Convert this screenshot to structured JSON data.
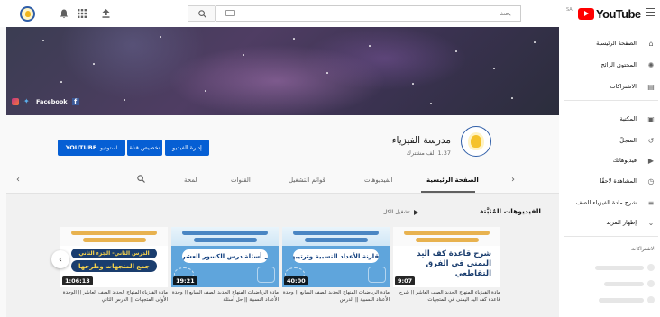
{
  "topbar": {
    "search_placeholder": "بحث",
    "logo_text": "YouTube",
    "logo_sup": "SA"
  },
  "banner": {
    "facebook_label": "Facebook"
  },
  "channel": {
    "name": "مدرسة الفيزياء",
    "subscribers": "1.37 ألف مشترك",
    "btn_youtube_main": "YOUTUBE",
    "btn_youtube_small": "استوديو",
    "btn_customize": "تخصيص قناة",
    "btn_manage": "إدارة الفيديو"
  },
  "tabs": [
    {
      "label": "الصفحة الرئيسية"
    },
    {
      "label": "الفيديوهات"
    },
    {
      "label": "قوائم التشغيل"
    },
    {
      "label": "القنوات"
    },
    {
      "label": "لمحة"
    }
  ],
  "shelf": {
    "title": "الفيديوهات المُثبَّتة",
    "play_all": "تشغيل الكل"
  },
  "videos": [
    {
      "thumb_text": "شرح قاعدة كف اليد اليمنى في الفرق التقاطعي",
      "duration": "9:07",
      "title": "مادة الفيزياء المنهاج الجديد الصف العاشر || شرح قاعدة كف اليد اليمنى في المتجهات"
    },
    {
      "thumb_text": "مقارنة الأعداد النسبية وترتيبها",
      "duration": "40:00",
      "title": "مادة الرياضيات المنهاج الجديد الصف السابع || وحدة الأعداد النسبية || الدرس"
    },
    {
      "thumb_text": "حل أسئلة درس الكسور العشرية",
      "duration": "19:21",
      "title": "مادة الرياضيات المنهاج الجديد الصف السابع || وحدة الأعداد النسبية || حل أسئلة"
    },
    {
      "thumb_text": "جمع المتجهات وطرحها",
      "thumb_sub": "الدرس الثاني- الجزء الثاني",
      "duration": "1:06:13",
      "title": "مادة الفيزياء المنهاج الجديد الصف العاشر || الوحدة الأولى المتجهات || الدرس الثاني"
    }
  ],
  "sidebar": {
    "items": [
      {
        "label": "الصفحة الرئيسية",
        "icon": "home-icon",
        "glyph": "⌂"
      },
      {
        "label": "المحتوى الرائج",
        "icon": "explore-icon",
        "glyph": "✺"
      },
      {
        "label": "الاشتراكات",
        "icon": "subscriptions-icon",
        "glyph": "▤"
      },
      {
        "label": "المكتبة",
        "icon": "library-icon",
        "glyph": "▣"
      },
      {
        "label": "السجلّ",
        "icon": "history-icon",
        "glyph": "↺"
      },
      {
        "label": "فيديوهاتك",
        "icon": "your-videos-icon",
        "glyph": "▶"
      },
      {
        "label": "المشاهدة لاحقًا",
        "icon": "watch-later-icon",
        "glyph": "◷"
      },
      {
        "label": "شرح مادة الفيزياء للصف",
        "icon": "playlist-icon",
        "glyph": "≡"
      },
      {
        "label": "إظهار المزيد",
        "icon": "chevron-down-icon",
        "glyph": "⌄"
      }
    ],
    "section_title": "الاشتراكات"
  }
}
